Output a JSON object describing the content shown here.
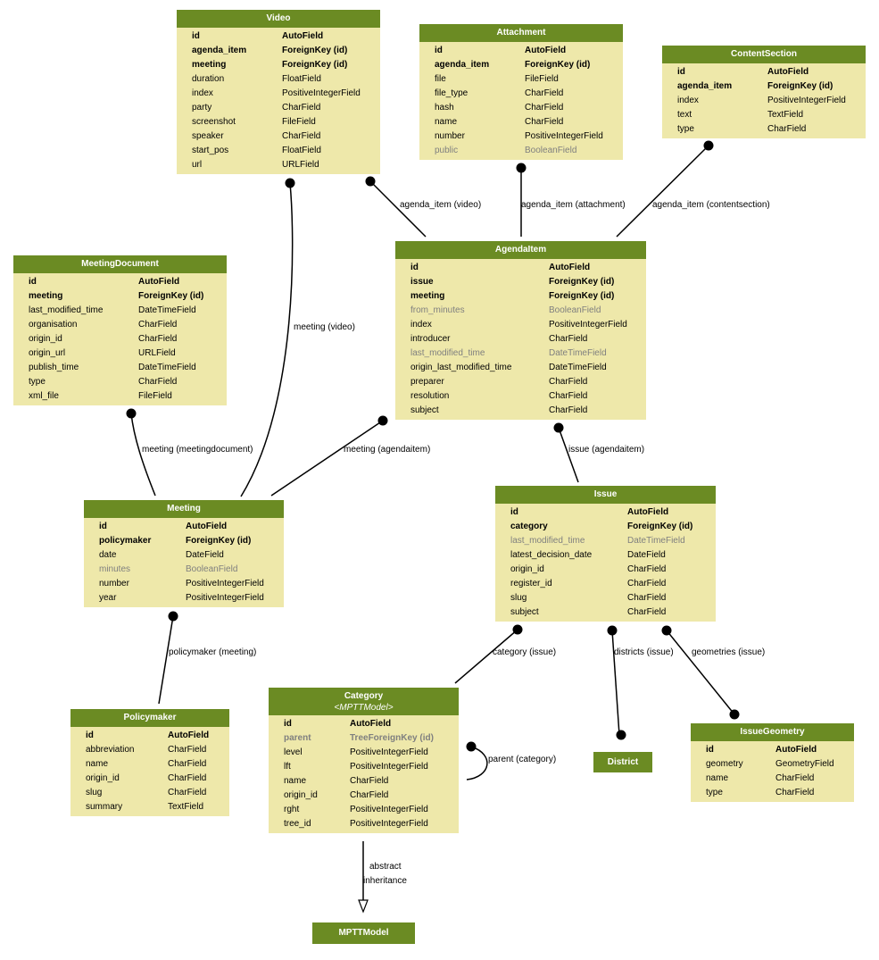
{
  "colors": {
    "header": "#6b8b23",
    "body": "#eee8aa",
    "muted_text": "#7f7f7f",
    "edge": "#000000"
  },
  "models": {
    "video": {
      "title": "Video",
      "fields": [
        {
          "name": "id",
          "type": "AutoField",
          "style": "bold"
        },
        {
          "name": "agenda_item",
          "type": "ForeignKey (id)",
          "style": "bold"
        },
        {
          "name": "meeting",
          "type": "ForeignKey (id)",
          "style": "bold"
        },
        {
          "name": "duration",
          "type": "FloatField",
          "style": "normal"
        },
        {
          "name": "index",
          "type": "PositiveIntegerField",
          "style": "normal"
        },
        {
          "name": "party",
          "type": "CharField",
          "style": "normal"
        },
        {
          "name": "screenshot",
          "type": "FileField",
          "style": "normal"
        },
        {
          "name": "speaker",
          "type": "CharField",
          "style": "normal"
        },
        {
          "name": "start_pos",
          "type": "FloatField",
          "style": "normal"
        },
        {
          "name": "url",
          "type": "URLField",
          "style": "normal"
        }
      ]
    },
    "attachment": {
      "title": "Attachment",
      "fields": [
        {
          "name": "id",
          "type": "AutoField",
          "style": "bold"
        },
        {
          "name": "agenda_item",
          "type": "ForeignKey (id)",
          "style": "bold"
        },
        {
          "name": "file",
          "type": "FileField",
          "style": "normal"
        },
        {
          "name": "file_type",
          "type": "CharField",
          "style": "normal"
        },
        {
          "name": "hash",
          "type": "CharField",
          "style": "normal"
        },
        {
          "name": "name",
          "type": "CharField",
          "style": "normal"
        },
        {
          "name": "number",
          "type": "PositiveIntegerField",
          "style": "normal"
        },
        {
          "name": "public",
          "type": "BooleanField",
          "style": "grey"
        }
      ]
    },
    "contentsection": {
      "title": "ContentSection",
      "fields": [
        {
          "name": "id",
          "type": "AutoField",
          "style": "bold"
        },
        {
          "name": "agenda_item",
          "type": "ForeignKey (id)",
          "style": "bold"
        },
        {
          "name": "index",
          "type": "PositiveIntegerField",
          "style": "normal"
        },
        {
          "name": "text",
          "type": "TextField",
          "style": "normal"
        },
        {
          "name": "type",
          "type": "CharField",
          "style": "normal"
        }
      ]
    },
    "agendaitem": {
      "title": "AgendaItem",
      "fields": [
        {
          "name": "id",
          "type": "AutoField",
          "style": "bold"
        },
        {
          "name": "issue",
          "type": "ForeignKey (id)",
          "style": "bold"
        },
        {
          "name": "meeting",
          "type": "ForeignKey (id)",
          "style": "bold"
        },
        {
          "name": "from_minutes",
          "type": "BooleanField",
          "style": "grey"
        },
        {
          "name": "index",
          "type": "PositiveIntegerField",
          "style": "normal"
        },
        {
          "name": "introducer",
          "type": "CharField",
          "style": "normal"
        },
        {
          "name": "last_modified_time",
          "type": "DateTimeField",
          "style": "grey"
        },
        {
          "name": "origin_last_modified_time",
          "type": "DateTimeField",
          "style": "normal"
        },
        {
          "name": "preparer",
          "type": "CharField",
          "style": "normal"
        },
        {
          "name": "resolution",
          "type": "CharField",
          "style": "normal"
        },
        {
          "name": "subject",
          "type": "CharField",
          "style": "normal"
        }
      ]
    },
    "meetingdocument": {
      "title": "MeetingDocument",
      "fields": [
        {
          "name": "id",
          "type": "AutoField",
          "style": "bold"
        },
        {
          "name": "meeting",
          "type": "ForeignKey (id)",
          "style": "bold"
        },
        {
          "name": "last_modified_time",
          "type": "DateTimeField",
          "style": "normal"
        },
        {
          "name": "organisation",
          "type": "CharField",
          "style": "normal"
        },
        {
          "name": "origin_id",
          "type": "CharField",
          "style": "normal"
        },
        {
          "name": "origin_url",
          "type": "URLField",
          "style": "normal"
        },
        {
          "name": "publish_time",
          "type": "DateTimeField",
          "style": "normal"
        },
        {
          "name": "type",
          "type": "CharField",
          "style": "normal"
        },
        {
          "name": "xml_file",
          "type": "FileField",
          "style": "normal"
        }
      ]
    },
    "meeting": {
      "title": "Meeting",
      "fields": [
        {
          "name": "id",
          "type": "AutoField",
          "style": "bold"
        },
        {
          "name": "policymaker",
          "type": "ForeignKey (id)",
          "style": "bold"
        },
        {
          "name": "date",
          "type": "DateField",
          "style": "normal"
        },
        {
          "name": "minutes",
          "type": "BooleanField",
          "style": "grey"
        },
        {
          "name": "number",
          "type": "PositiveIntegerField",
          "style": "normal"
        },
        {
          "name": "year",
          "type": "PositiveIntegerField",
          "style": "normal"
        }
      ]
    },
    "issue": {
      "title": "Issue",
      "fields": [
        {
          "name": "id",
          "type": "AutoField",
          "style": "bold"
        },
        {
          "name": "category",
          "type": "ForeignKey (id)",
          "style": "bold"
        },
        {
          "name": "last_modified_time",
          "type": "DateTimeField",
          "style": "grey"
        },
        {
          "name": "latest_decision_date",
          "type": "DateField",
          "style": "normal"
        },
        {
          "name": "origin_id",
          "type": "CharField",
          "style": "normal"
        },
        {
          "name": "register_id",
          "type": "CharField",
          "style": "normal"
        },
        {
          "name": "slug",
          "type": "CharField",
          "style": "normal"
        },
        {
          "name": "subject",
          "type": "CharField",
          "style": "normal"
        }
      ]
    },
    "policymaker": {
      "title": "Policymaker",
      "fields": [
        {
          "name": "id",
          "type": "AutoField",
          "style": "bold"
        },
        {
          "name": "abbreviation",
          "type": "CharField",
          "style": "normal"
        },
        {
          "name": "name",
          "type": "CharField",
          "style": "normal"
        },
        {
          "name": "origin_id",
          "type": "CharField",
          "style": "normal"
        },
        {
          "name": "slug",
          "type": "CharField",
          "style": "normal"
        },
        {
          "name": "summary",
          "type": "TextField",
          "style": "normal"
        }
      ]
    },
    "category": {
      "title": "Category",
      "subtitle": "<MPTTModel>",
      "fields": [
        {
          "name": "id",
          "type": "AutoField",
          "style": "bold"
        },
        {
          "name": "parent",
          "type": "TreeForeignKey (id)",
          "style": "boldgrey"
        },
        {
          "name": "level",
          "type": "PositiveIntegerField",
          "style": "normal"
        },
        {
          "name": "lft",
          "type": "PositiveIntegerField",
          "style": "normal"
        },
        {
          "name": "name",
          "type": "CharField",
          "style": "normal"
        },
        {
          "name": "origin_id",
          "type": "CharField",
          "style": "normal"
        },
        {
          "name": "rght",
          "type": "PositiveIntegerField",
          "style": "normal"
        },
        {
          "name": "tree_id",
          "type": "PositiveIntegerField",
          "style": "normal"
        }
      ]
    },
    "issuegeometry": {
      "title": "IssueGeometry",
      "fields": [
        {
          "name": "id",
          "type": "AutoField",
          "style": "bold"
        },
        {
          "name": "geometry",
          "type": "GeometryField",
          "style": "normal"
        },
        {
          "name": "name",
          "type": "CharField",
          "style": "normal"
        },
        {
          "name": "type",
          "type": "CharField",
          "style": "normal"
        }
      ]
    },
    "district": {
      "title": "District"
    },
    "mpttmodel": {
      "title": "MPTTModel"
    }
  },
  "edges": {
    "agenda_item_video": "agenda_item (video)",
    "agenda_item_attachment": "agenda_item (attachment)",
    "agenda_item_contentsection": "agenda_item (contentsection)",
    "meeting_video": "meeting (video)",
    "meeting_meetingdocument": "meeting (meetingdocument)",
    "meeting_agendaitem": "meeting (agendaitem)",
    "issue_agendaitem": "issue (agendaitem)",
    "policymaker_meeting": "policymaker (meeting)",
    "category_issue": "category (issue)",
    "districts_issue": "districts (issue)",
    "geometries_issue": "geometries (issue)",
    "parent_category": "parent (category)",
    "abstract_inheritance_line1": "abstract",
    "abstract_inheritance_line2": "inheritance"
  }
}
